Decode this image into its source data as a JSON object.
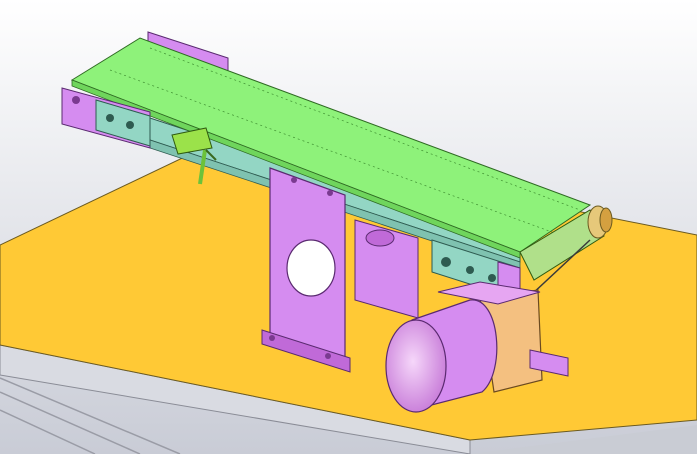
{
  "viewport": {
    "background_top": "#ffffff",
    "background_bottom": "#c9ccd6"
  },
  "model": {
    "parts": [
      {
        "name": "base-plate",
        "color": "#ffc935"
      },
      {
        "name": "conveyor-belt",
        "color": "#8ef27a"
      },
      {
        "name": "side-frame",
        "color": "#93d6c4"
      },
      {
        "name": "support-bracket",
        "color": "#d58cf0"
      },
      {
        "name": "gear-motor",
        "color": "#e6a6f2"
      },
      {
        "name": "gearbox",
        "color": "#f4c080"
      },
      {
        "name": "sensor",
        "color": "#9be24a"
      },
      {
        "name": "tension-block",
        "color": "#c77ae0"
      },
      {
        "name": "drive-roller",
        "color": "#b0e08a"
      },
      {
        "name": "end-plate",
        "color": "#44dfe8"
      }
    ]
  }
}
